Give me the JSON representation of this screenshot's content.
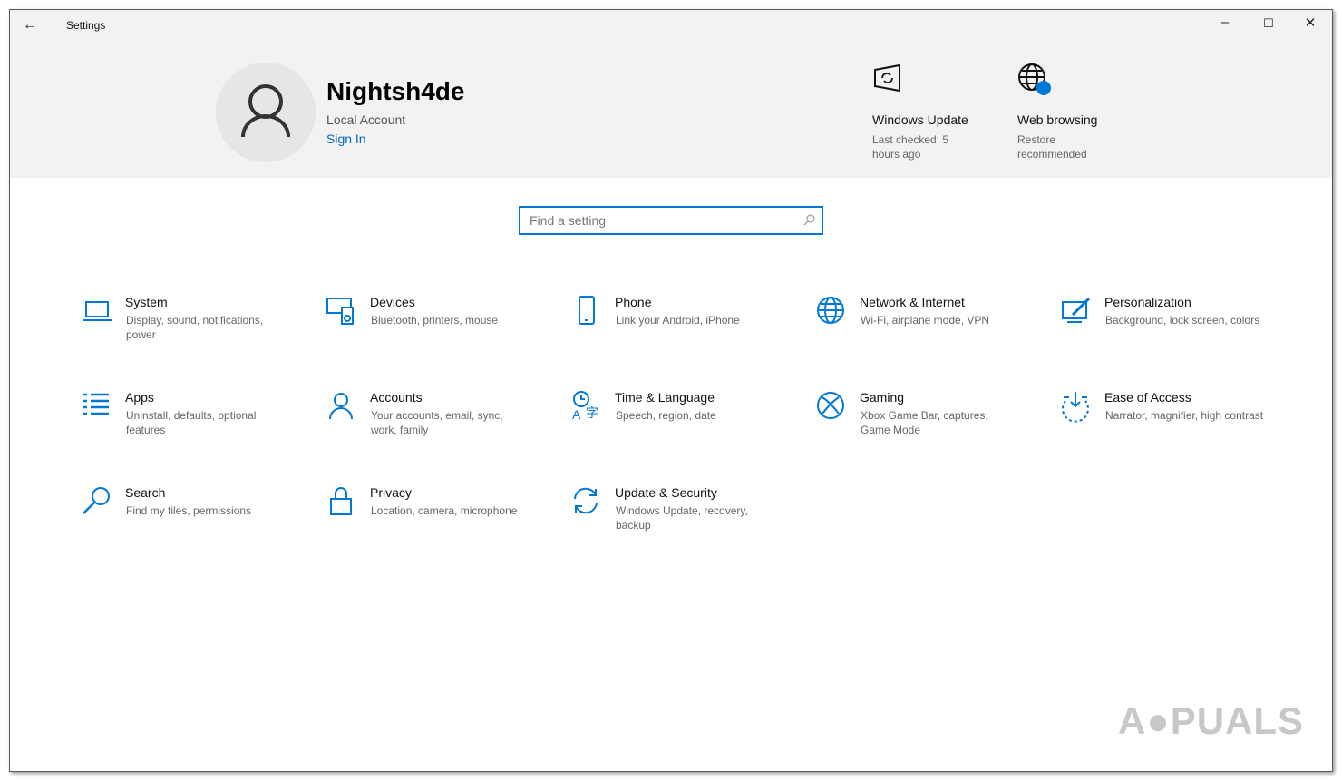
{
  "window": {
    "title": "Settings"
  },
  "user": {
    "name": "Nightsh4de",
    "account_type": "Local Account",
    "sign_in": "Sign In"
  },
  "tiles": [
    {
      "title": "Windows Update",
      "subtitle": "Last checked: 5 hours ago",
      "icon": "windows-update-icon"
    },
    {
      "title": "Web browsing",
      "subtitle": "Restore recommended",
      "icon": "globe-icon"
    }
  ],
  "search": {
    "placeholder": "Find a setting"
  },
  "categories": [
    {
      "name": "System",
      "desc": "Display, sound, notifications, power"
    },
    {
      "name": "Devices",
      "desc": "Bluetooth, printers, mouse"
    },
    {
      "name": "Phone",
      "desc": "Link your Android, iPhone"
    },
    {
      "name": "Network & Internet",
      "desc": "Wi-Fi, airplane mode, VPN"
    },
    {
      "name": "Personalization",
      "desc": "Background, lock screen, colors"
    },
    {
      "name": "Apps",
      "desc": "Uninstall, defaults, optional features"
    },
    {
      "name": "Accounts",
      "desc": "Your accounts, email, sync, work, family"
    },
    {
      "name": "Time & Language",
      "desc": "Speech, region, date"
    },
    {
      "name": "Gaming",
      "desc": "Xbox Game Bar, captures, Game Mode"
    },
    {
      "name": "Ease of Access",
      "desc": "Narrator, magnifier, high contrast"
    },
    {
      "name": "Search",
      "desc": "Find my files, permissions"
    },
    {
      "name": "Privacy",
      "desc": "Location, camera, microphone"
    },
    {
      "name": "Update & Security",
      "desc": "Windows Update, recovery, backup"
    }
  ],
  "watermark": "APPUALS",
  "colors": {
    "accent": "#0078d7",
    "header": "#f2f2f2"
  }
}
